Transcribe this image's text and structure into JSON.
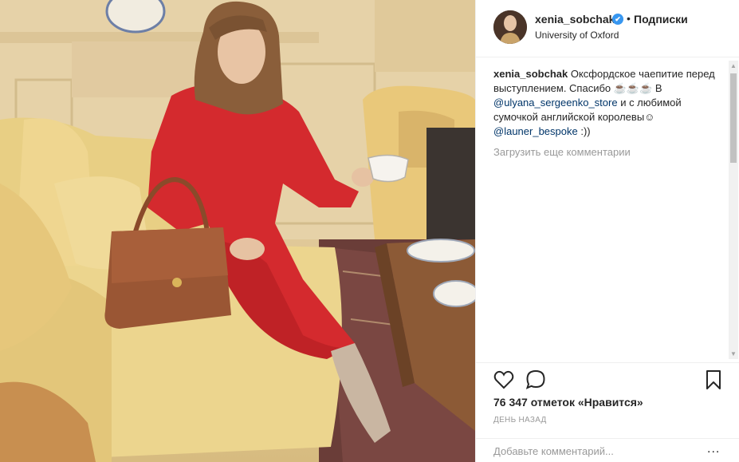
{
  "post": {
    "username": "xenia_sobchak",
    "verified_badge": "✔",
    "separator": "•",
    "follow_status": "Подписки",
    "location": "University of Oxford"
  },
  "caption": {
    "username": "xenia_sobchak",
    "text_1": " Оксфордское чаепитие перед выступлением. Спасибо ☕☕☕ В ",
    "mention_1": "@ulyana_sergeenko_store",
    "text_2": " и с любимой сумочкой английской королевы☺ ",
    "mention_2": "@launer_bespoke",
    "text_3": " :))"
  },
  "comments": {
    "load_more": "Загрузить еще комментарии"
  },
  "actions": {
    "like_icon": "heart-icon",
    "comment_icon": "comment-bubble-icon",
    "save_icon": "bookmark-icon",
    "likes_text": "76 347 отметок «Нравится»",
    "timestamp": "ДЕНЬ НАЗАД"
  },
  "add_comment": {
    "placeholder": "Добавьте комментарий...",
    "more": "..."
  },
  "colors": {
    "mention": "#003569",
    "verified": "#3897f0",
    "muted_text": "#999999"
  }
}
